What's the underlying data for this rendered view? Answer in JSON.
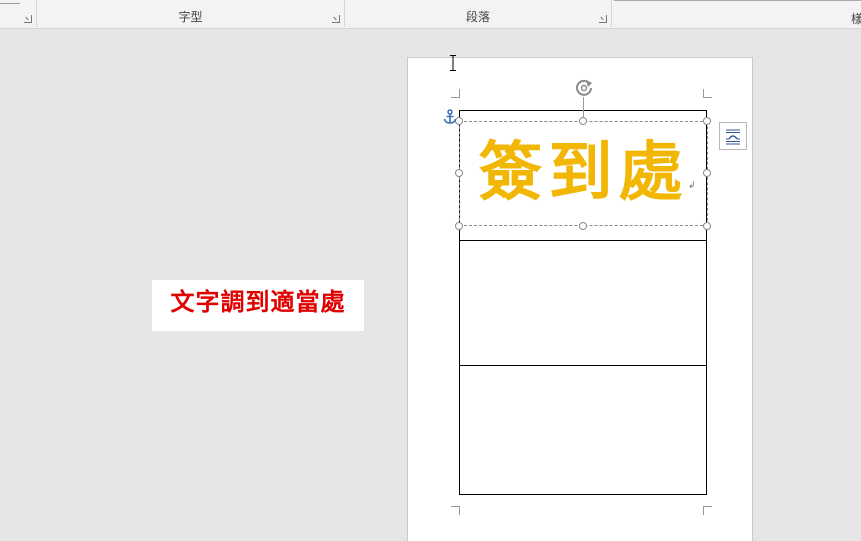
{
  "ribbon": {
    "groups": [
      {
        "label": "字型"
      },
      {
        "label": "段落"
      }
    ],
    "partial_label": "樣"
  },
  "document": {
    "textbox_text": "簽到處",
    "textbox_color": "#f2b705",
    "paragraph_mark": "↲"
  },
  "annotation": {
    "text": "文字調到適當處",
    "color": "#e00000"
  },
  "icons": {
    "rotate": "rotate-handle-icon",
    "anchor": "anchor-icon",
    "layout_options": "layout-options-icon",
    "text_cursor": "ibeam-cursor-icon",
    "dialog_launcher": "dialog-launcher-icon"
  }
}
